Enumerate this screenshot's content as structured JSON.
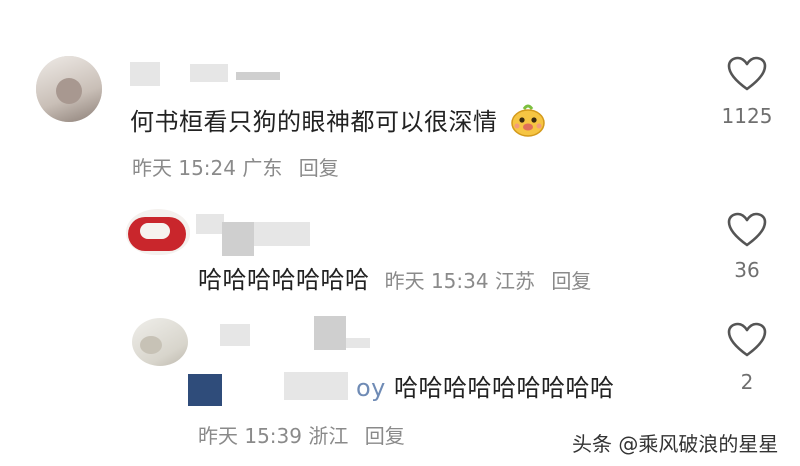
{
  "comments": [
    {
      "text": "何书桓看只狗的眼神都可以很深情",
      "emoji_icon": "mole-face-emoji-icon",
      "time": "昨天 15:24",
      "location": "广东",
      "reply_label": "回复",
      "likes": "1125"
    },
    {
      "text": "哈哈哈哈哈哈哈",
      "time": "昨天 15:34",
      "location": "江苏",
      "reply_label": "回复",
      "likes": "36"
    },
    {
      "text_prefix": "oy",
      "text": "哈哈哈哈哈哈哈哈哈",
      "time": "昨天 15:39",
      "location": "浙江",
      "reply_label": "回复",
      "likes": "2"
    }
  ],
  "watermark": "头条 @乘风破浪的星星",
  "colors": {
    "meta": "#8a8a8a",
    "heart_stroke": "#555555",
    "emoji": "#f6c543"
  }
}
